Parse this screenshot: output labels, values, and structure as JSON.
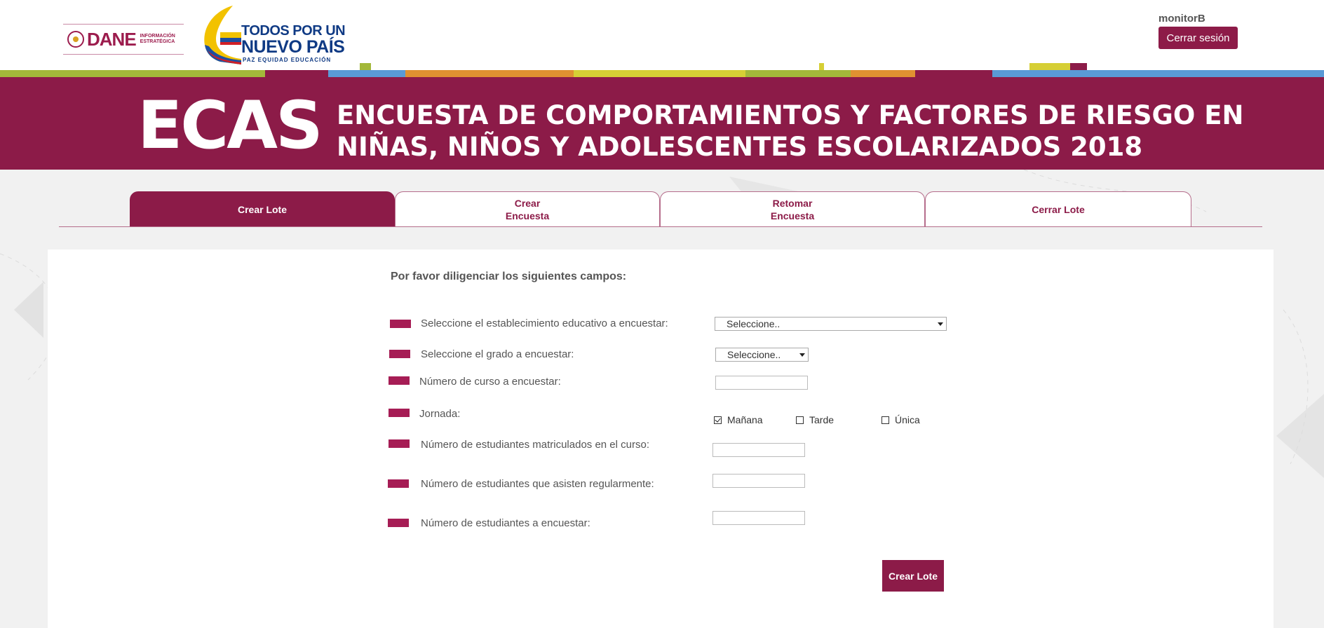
{
  "header": {
    "dane_logo": {
      "word": "DANE",
      "subtitle_line1": "INFORMACIÓN",
      "subtitle_line2": "ESTRATÉGICA"
    },
    "gov_logo": {
      "line1": "TODOS POR UN",
      "line2": "NUEVO PAÍS",
      "line3": "PAZ  EQUIDAD  EDUCACIÓN"
    },
    "username": "monitorB",
    "logout_label": "Cerrar sesión"
  },
  "banner": {
    "acronym": "ECAS",
    "title_line1": "ENCUESTA DE COMPORTAMIENTOS Y FACTORES DE RIESGO EN",
    "title_line2": "NIÑAS, NIÑOS Y ADOLESCENTES ESCOLARIZADOS 2018",
    "color": "#8c1b48"
  },
  "tabs": [
    {
      "label": "Crear Lote",
      "active": true
    },
    {
      "label": "Crear\nEncuesta",
      "active": false
    },
    {
      "label": "Retomar\nEncuesta",
      "active": false
    },
    {
      "label": "Cerrar Lote",
      "active": false
    }
  ],
  "form": {
    "intro": "Por favor diligenciar los siguientes campos:",
    "establishment": {
      "label": "Seleccione el establecimiento educativo a encuestar:",
      "value": "Seleccione.."
    },
    "grade": {
      "label": "Seleccione el grado a encuestar:",
      "value": "Seleccione.."
    },
    "course_number": {
      "label": "Número de curso a encuestar:",
      "value": ""
    },
    "shift": {
      "label": "Jornada:",
      "options": [
        {
          "label": "Mañana",
          "checked": true
        },
        {
          "label": "Tarde",
          "checked": false
        },
        {
          "label": "Única",
          "checked": false
        }
      ]
    },
    "enrolled": {
      "label": "Número de estudiantes matriculados en el curso:",
      "value": ""
    },
    "attending": {
      "label": "Número de estudiantes que asisten regularmente:",
      "value": ""
    },
    "to_survey": {
      "label": "Número de estudiantes a encuestar:",
      "value": ""
    },
    "submit_label": "Crear Lote"
  }
}
